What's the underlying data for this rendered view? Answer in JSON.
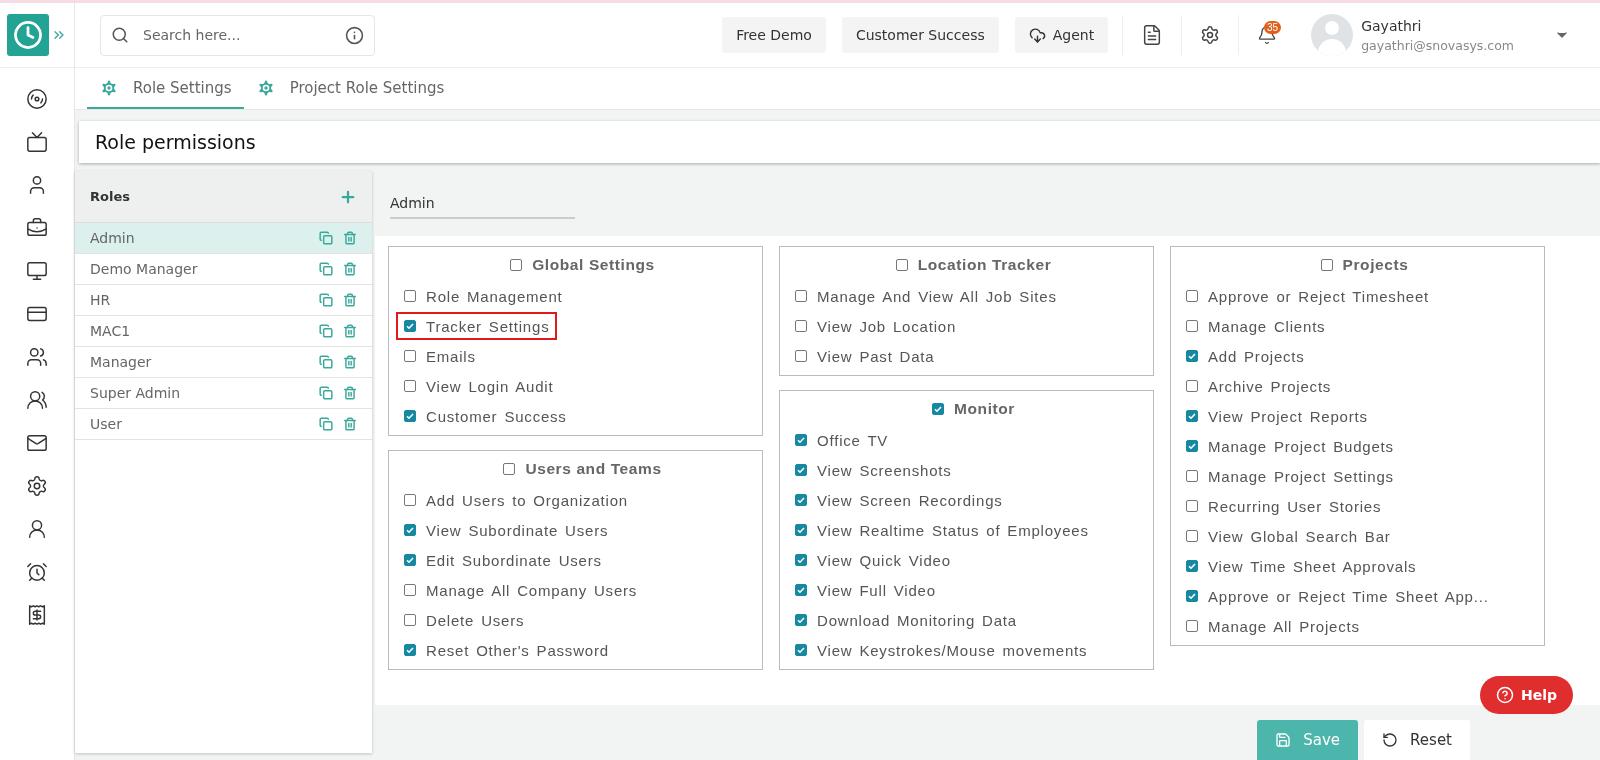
{
  "search": {
    "placeholder": "Search here..."
  },
  "header_buttons": [
    {
      "label": "Free Demo",
      "kind": "plain"
    },
    {
      "label": "Customer Success",
      "kind": "plain"
    },
    {
      "label": "Agent",
      "kind": "cloud"
    }
  ],
  "notifications": {
    "count": "35"
  },
  "user": {
    "name": "Gayathri",
    "email": "gayathri@snovasys.com"
  },
  "sidebar": {
    "items": [
      {
        "kind": "gauge"
      },
      {
        "kind": "tv"
      },
      {
        "kind": "user"
      },
      {
        "kind": "briefcase"
      },
      {
        "kind": "monitor"
      },
      {
        "kind": "card"
      },
      {
        "kind": "users"
      },
      {
        "kind": "team"
      },
      {
        "kind": "mail"
      },
      {
        "kind": "settings"
      },
      {
        "kind": "person"
      },
      {
        "kind": "alarm"
      },
      {
        "kind": "invoice"
      }
    ]
  },
  "tabs": [
    {
      "label": "Role Settings",
      "selected": true
    },
    {
      "label": "Project Role Settings",
      "selected": false
    }
  ],
  "page_title": "Role permissions",
  "roles": {
    "title": "Roles",
    "items": [
      {
        "name": "Admin",
        "selected": true
      },
      {
        "name": "Demo Manager",
        "selected": false
      },
      {
        "name": "HR",
        "selected": false
      },
      {
        "name": "MAC1",
        "selected": false
      },
      {
        "name": "Manager",
        "selected": false
      },
      {
        "name": "Super Admin",
        "selected": false
      },
      {
        "name": "User",
        "selected": false
      }
    ]
  },
  "role_name": "Admin",
  "columns": [
    [
      {
        "title": "Global Settings",
        "checked": false,
        "items": [
          {
            "label": "Role Management",
            "checked": false,
            "highlighted": false
          },
          {
            "label": "Tracker Settings",
            "checked": true,
            "highlighted": true
          },
          {
            "label": "Emails",
            "checked": false,
            "highlighted": false
          },
          {
            "label": "View Login Audit",
            "checked": false,
            "highlighted": false
          },
          {
            "label": "Customer Success",
            "checked": true,
            "highlighted": false
          }
        ]
      },
      {
        "title": "Users and Teams",
        "checked": false,
        "items": [
          {
            "label": "Add Users to Organization",
            "checked": false,
            "highlighted": false
          },
          {
            "label": "View Subordinate Users",
            "checked": true,
            "highlighted": false
          },
          {
            "label": "Edit Subordinate Users",
            "checked": true,
            "highlighted": false
          },
          {
            "label": "Manage All Company Users",
            "checked": false,
            "highlighted": false
          },
          {
            "label": "Delete Users",
            "checked": false,
            "highlighted": false
          },
          {
            "label": "Reset Other's Password",
            "checked": true,
            "highlighted": false
          }
        ]
      }
    ],
    [
      {
        "title": "Location Tracker",
        "checked": false,
        "items": [
          {
            "label": "Manage And View All Job Sites",
            "checked": false,
            "highlighted": false
          },
          {
            "label": "View Job Location",
            "checked": false,
            "highlighted": false
          },
          {
            "label": "View Past Data",
            "checked": false,
            "highlighted": false
          }
        ]
      },
      {
        "title": "Monitor",
        "checked": true,
        "items": [
          {
            "label": "Office TV",
            "checked": true,
            "highlighted": false
          },
          {
            "label": "View Screenshots",
            "checked": true,
            "highlighted": false
          },
          {
            "label": "View Screen Recordings",
            "checked": true,
            "highlighted": false
          },
          {
            "label": "View Realtime Status of Employees",
            "checked": true,
            "highlighted": false
          },
          {
            "label": "View Quick Video",
            "checked": true,
            "highlighted": false
          },
          {
            "label": "View Full Video",
            "checked": true,
            "highlighted": false
          },
          {
            "label": "Download Monitoring Data",
            "checked": true,
            "highlighted": false
          },
          {
            "label": "View Keystrokes/Mouse movements",
            "checked": true,
            "highlighted": false
          }
        ]
      }
    ],
    [
      {
        "title": "Projects",
        "checked": false,
        "items": [
          {
            "label": "Approve or Reject Timesheet",
            "checked": false,
            "highlighted": false
          },
          {
            "label": "Manage Clients",
            "checked": false,
            "highlighted": false
          },
          {
            "label": "Add Projects",
            "checked": true,
            "highlighted": false
          },
          {
            "label": "Archive Projects",
            "checked": false,
            "highlighted": false
          },
          {
            "label": "View Project Reports",
            "checked": true,
            "highlighted": false
          },
          {
            "label": "Manage Project Budgets",
            "checked": true,
            "highlighted": false
          },
          {
            "label": "Manage Project Settings",
            "checked": false,
            "highlighted": false
          },
          {
            "label": "Recurring User Stories",
            "checked": false,
            "highlighted": false
          },
          {
            "label": "View Global Search Bar",
            "checked": false,
            "highlighted": false
          },
          {
            "label": "View Time Sheet Approvals",
            "checked": true,
            "highlighted": false
          },
          {
            "label": "Approve or Reject Time Sheet App...",
            "checked": true,
            "highlighted": false
          },
          {
            "label": "Manage All Projects",
            "checked": false,
            "highlighted": false
          }
        ]
      }
    ]
  ],
  "footer_buttons": [
    {
      "label": "Save",
      "kind": "save"
    },
    {
      "label": "Reset",
      "kind": "reset"
    }
  ],
  "help": {
    "label": "Help"
  }
}
